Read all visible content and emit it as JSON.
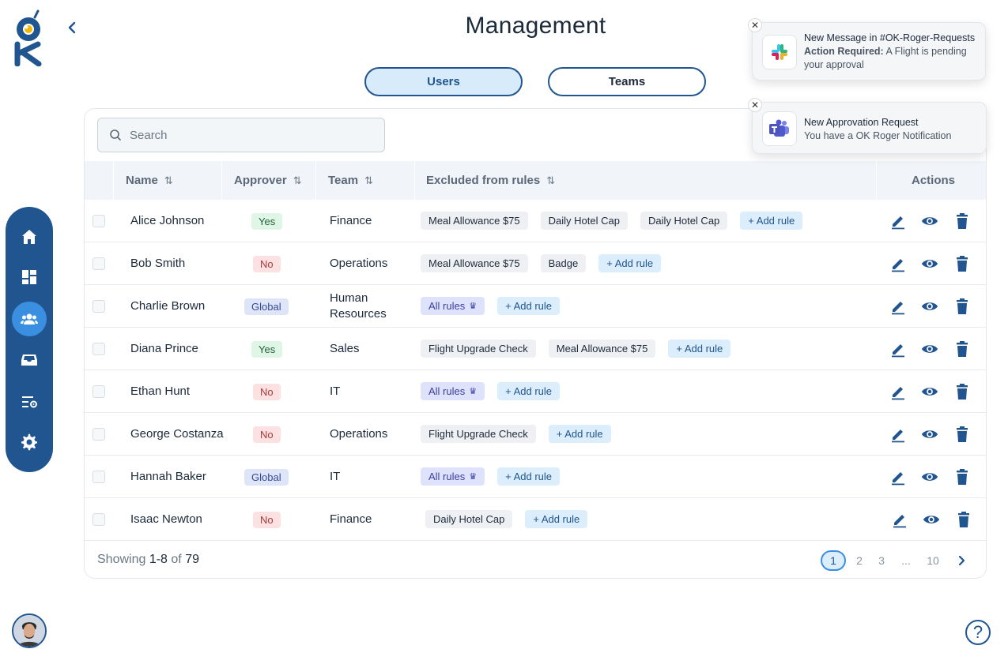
{
  "page": {
    "title": "Management"
  },
  "tabs": [
    {
      "label": "Users"
    },
    {
      "label": "Teams"
    }
  ],
  "search": {
    "placeholder": "Search",
    "value": ""
  },
  "table": {
    "columns": {
      "name": "Name",
      "approver": "Approver",
      "team": "Team",
      "excluded": "Excluded from rules",
      "actions": "Actions"
    },
    "add_rule_label": "+ Add rule",
    "rows": [
      {
        "name": "Alice Johnson",
        "approver": "Yes",
        "team": "Finance",
        "rules": [
          "Meal Allowance $75",
          "Daily Hotel Cap",
          "Daily Hotel Cap"
        ]
      },
      {
        "name": "Bob Smith",
        "approver": "No",
        "team": "Operations",
        "rules": [
          "Meal Allowance $75",
          "Badge"
        ]
      },
      {
        "name": "Charlie Brown",
        "approver": "Global",
        "team": "Human Resources",
        "rules": [
          "All rules"
        ]
      },
      {
        "name": "Diana Prince",
        "approver": "Yes",
        "team": "Sales",
        "rules": [
          "Flight Upgrade Check",
          "Meal Allowance $75"
        ]
      },
      {
        "name": "Ethan Hunt",
        "approver": "No",
        "team": "IT",
        "rules": [
          "All rules"
        ]
      },
      {
        "name": "George Costanza",
        "approver": "No",
        "team": "Operations",
        "rules": [
          "Flight Upgrade Check"
        ]
      },
      {
        "name": "Hannah Baker",
        "approver": "Global",
        "team": "IT",
        "rules": [
          "All rules"
        ]
      },
      {
        "name": "Isaac Newton",
        "approver": "No",
        "team": "Finance",
        "rules": [
          "Daily Hotel Cap"
        ]
      }
    ]
  },
  "footer": {
    "showing_prefix": "Showing",
    "range": "1-8",
    "of": "of",
    "total": "79"
  },
  "pagination": {
    "pages": [
      "1",
      "2",
      "3",
      "...",
      "10"
    ],
    "current": "1"
  },
  "notifications": [
    {
      "app": "slack-icon",
      "title": "New Message in #OK-Roger-Requests",
      "bold_prefix": "Action Required:",
      "body": "A Flight is pending your approval"
    },
    {
      "app": "teams-icon",
      "title": "New Approvation Request",
      "body": "You have a OK Roger Notification"
    }
  ],
  "nav": {
    "items": [
      {
        "icon": "home-icon",
        "active": false
      },
      {
        "icon": "dashboard-icon",
        "active": false
      },
      {
        "icon": "users-icon",
        "active": true
      },
      {
        "icon": "inbox-icon",
        "active": false
      },
      {
        "icon": "rules-settings-icon",
        "active": false
      },
      {
        "icon": "gear-icon",
        "active": false
      }
    ]
  },
  "help": {
    "label": "?"
  },
  "colors": {
    "primary": "#20558f",
    "accent": "#3a8fe0",
    "logo_yellow": "#f2b705"
  }
}
